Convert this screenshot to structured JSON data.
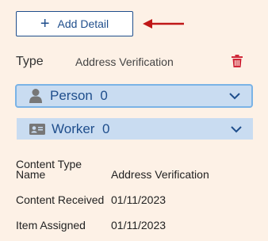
{
  "toolbar": {
    "add_detail_label": "Add Detail"
  },
  "type": {
    "label": "Type",
    "value": "Address Verification"
  },
  "panels": [
    {
      "label": "Person",
      "count": "0",
      "icon": "person-icon"
    },
    {
      "label": "Worker",
      "count": "0",
      "icon": "id-card-icon"
    }
  ],
  "details": [
    {
      "label_line1": "Content Type",
      "label_line2": "Name",
      "value": "Address Verification"
    },
    {
      "label": "Content Received",
      "value": "01/11/2023"
    },
    {
      "label": "Item Assigned",
      "value": "01/11/2023"
    }
  ],
  "colors": {
    "background": "#fdf1e6",
    "accent": "#1f4e8c",
    "panel_bg": "#c9dcf1",
    "panel_border": "#7ab3e6",
    "arrow": "#c01818",
    "trash": "#d0283a"
  }
}
